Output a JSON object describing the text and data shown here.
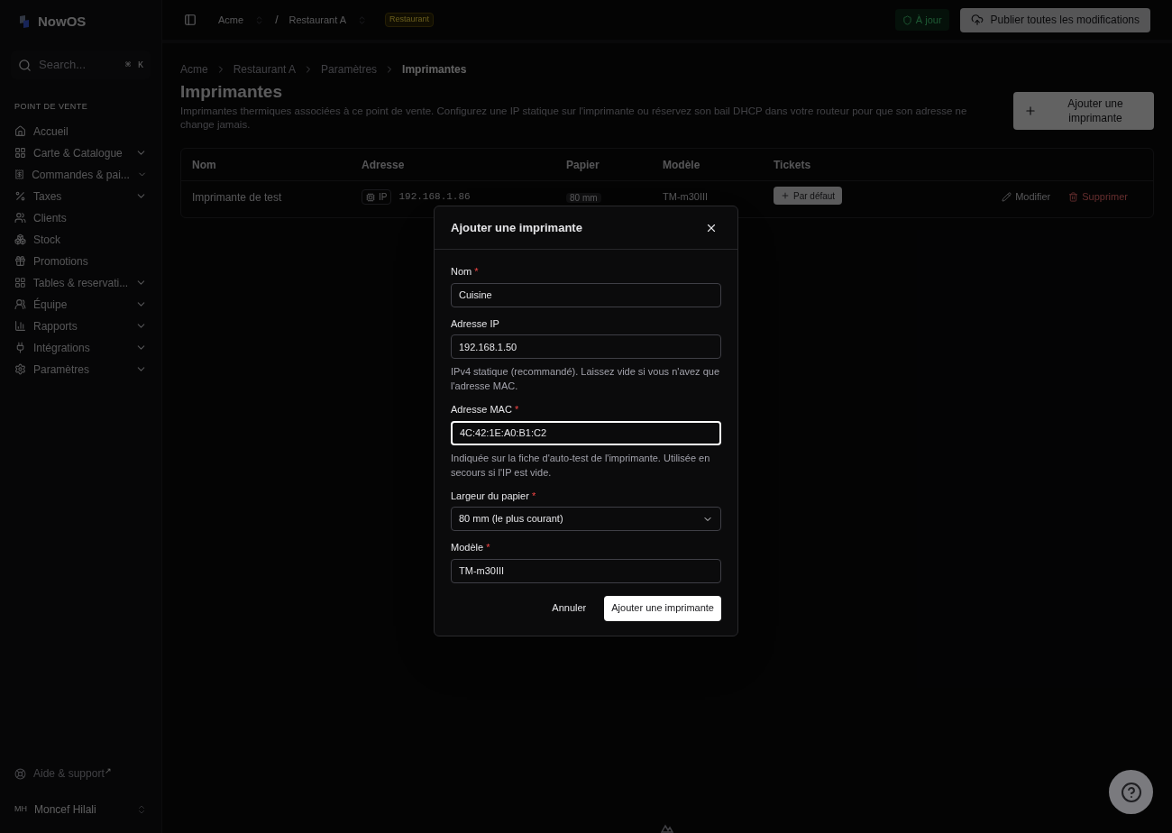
{
  "sidebar": {
    "brand": "NowOS",
    "search": {
      "placeholder": "Search...",
      "shortcut": [
        "⌘",
        "K"
      ]
    },
    "section": "POINT DE VENTE",
    "items": [
      {
        "label": "Accueil",
        "expandable": false
      },
      {
        "label": "Carte & Catalogue",
        "expandable": true
      },
      {
        "label": "Commandes & pai...",
        "expandable": true
      },
      {
        "label": "Taxes",
        "expandable": true
      },
      {
        "label": "Clients",
        "expandable": false
      },
      {
        "label": "Stock",
        "expandable": false
      },
      {
        "label": "Promotions",
        "expandable": false
      },
      {
        "label": "Tables & reservati...",
        "expandable": true
      },
      {
        "label": "Équipe",
        "expandable": true
      },
      {
        "label": "Rapports",
        "expandable": true
      },
      {
        "label": "Intégrations",
        "expandable": true
      },
      {
        "label": "Paramètres",
        "expandable": true
      }
    ],
    "help": {
      "label": "Aide & support",
      "mark": "↗"
    },
    "user": {
      "initials": "MH",
      "name": "Moncef Hilali"
    }
  },
  "topbar": {
    "org": "Acme",
    "separator": "/",
    "location": "Restaurant A",
    "badge": "Restaurant",
    "status": "À jour",
    "publish": "Publier toutes les modifications"
  },
  "breadcrumbs": [
    "Acme",
    "Restaurant A",
    "Paramètres",
    "Imprimantes"
  ],
  "page": {
    "title": "Imprimantes",
    "description": "Imprimantes thermiques associées à ce point de vente. Configurez une IP statique sur l'imprimante ou réservez son bail DHCP dans votre routeur pour que son adresse ne change jamais.",
    "add_button": "Ajouter une imprimante"
  },
  "table": {
    "columns": [
      "Nom",
      "Adresse",
      "Papier",
      "Modèle",
      "Tickets"
    ],
    "rows": [
      {
        "name": "Imprimante de test",
        "address_type": "IP",
        "address": "192.168.1.86",
        "paper": "80 mm",
        "model": "TM-m30III",
        "ticket": "Par défaut",
        "edit": "Modifier",
        "delete": "Supprimer"
      }
    ]
  },
  "dialog": {
    "title": "Ajouter une imprimante",
    "required_mark": "*",
    "fields": [
      {
        "kind": "input",
        "label": "Nom",
        "required": true,
        "value": "Cuisine",
        "focused": false
      },
      {
        "kind": "input",
        "label": "Adresse IP",
        "required": false,
        "value": "192.168.1.50",
        "focused": false,
        "hint": "IPv4 statique (recommandé). Laissez vide si vous n'avez que l'adresse MAC."
      },
      {
        "kind": "input",
        "label": "Adresse MAC",
        "required": true,
        "value": "4C:42:1E:A0:B1:C2",
        "focused": true,
        "hint": "Indiquée sur la fiche d'auto-test de l'imprimante. Utilisée en secours si l'IP est vide."
      },
      {
        "kind": "select",
        "label": "Largeur du papier",
        "required": true,
        "value": "80 mm (le plus courant)",
        "focused": false
      },
      {
        "kind": "input",
        "label": "Modèle",
        "required": true,
        "value": "TM-m30III",
        "focused": false
      }
    ],
    "cancel": "Annuler",
    "submit": "Ajouter une imprimante"
  }
}
